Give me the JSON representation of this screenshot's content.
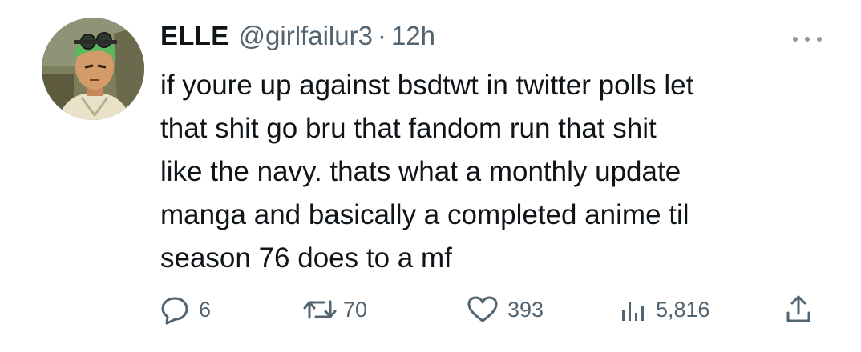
{
  "tweet": {
    "author": {
      "display_name": "ELLE",
      "handle": "@girlfailur3",
      "separator": "·",
      "timestamp": "12h"
    },
    "more_icon": "more-horizontal-icon",
    "text_lines": [
      "if youre up against bsdtwt in twitter polls let",
      "that shit go bru that fandom run that shit",
      "like the navy. thats what a monthly update",
      "manga and basically a completed anime til",
      "season 76 does to a mf"
    ],
    "actions": {
      "reply": {
        "icon": "reply-icon",
        "count": "6"
      },
      "retweet": {
        "icon": "retweet-icon",
        "count": "70"
      },
      "like": {
        "icon": "heart-icon",
        "count": "393"
      },
      "views": {
        "icon": "views-chart-icon",
        "count": "5,816"
      },
      "share": {
        "icon": "share-icon"
      }
    }
  },
  "colors": {
    "text": "#0f1419",
    "secondary": "#536471",
    "background": "#ffffff"
  }
}
